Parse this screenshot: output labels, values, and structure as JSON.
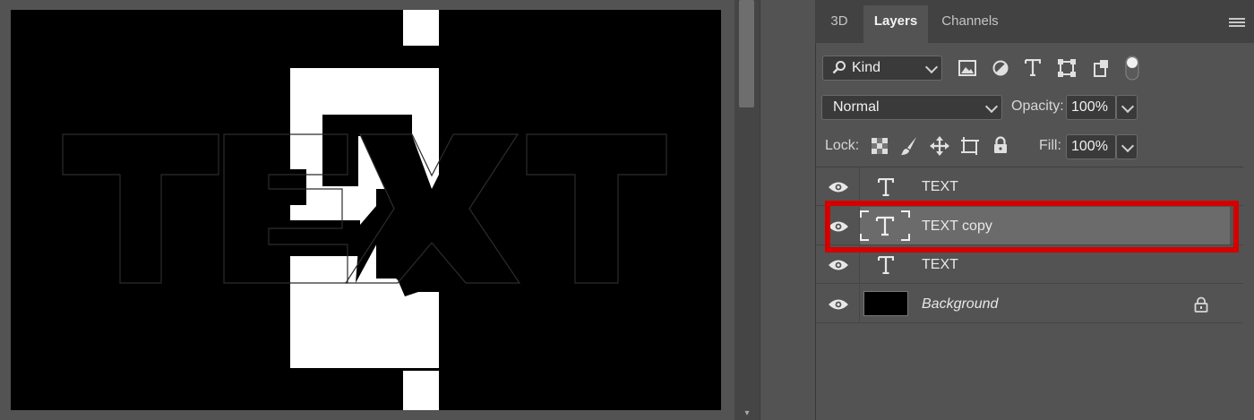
{
  "canvas": {
    "background": "#000000",
    "artwork_text": "TEXT"
  },
  "panel": {
    "tabs": [
      {
        "label": "3D"
      },
      {
        "label": "Layers"
      },
      {
        "label": "Channels"
      }
    ],
    "active_tab": "Layers",
    "filter": {
      "kind_value": "Kind"
    },
    "blend_mode": "Normal",
    "opacity_label": "Opacity:",
    "opacity_value": "100%",
    "lock_label": "Lock:",
    "fill_label": "Fill:",
    "fill_value": "100%",
    "filter_icons": [
      "image-filter-icon",
      "adjustment-filter-icon",
      "type-filter-icon",
      "shape-filter-icon",
      "smart-object-filter-icon",
      "filter-toggle-icon"
    ],
    "lock_icons": [
      "lock-transparent-pixels-icon",
      "lock-image-pixels-icon",
      "lock-position-icon",
      "lock-artboard-icon",
      "lock-all-icon"
    ]
  },
  "layers": [
    {
      "name": "TEXT",
      "type": "text",
      "visible": true,
      "selected": false
    },
    {
      "name": "TEXT copy",
      "type": "text",
      "visible": true,
      "selected": true
    },
    {
      "name": "TEXT",
      "type": "text",
      "visible": true,
      "selected": false
    },
    {
      "name": "Background",
      "type": "background",
      "visible": true,
      "selected": false,
      "locked": true
    }
  ],
  "colors": {
    "panel_bg": "#535353",
    "selected_row": "#6b6b6b",
    "highlight": "#d40000"
  }
}
